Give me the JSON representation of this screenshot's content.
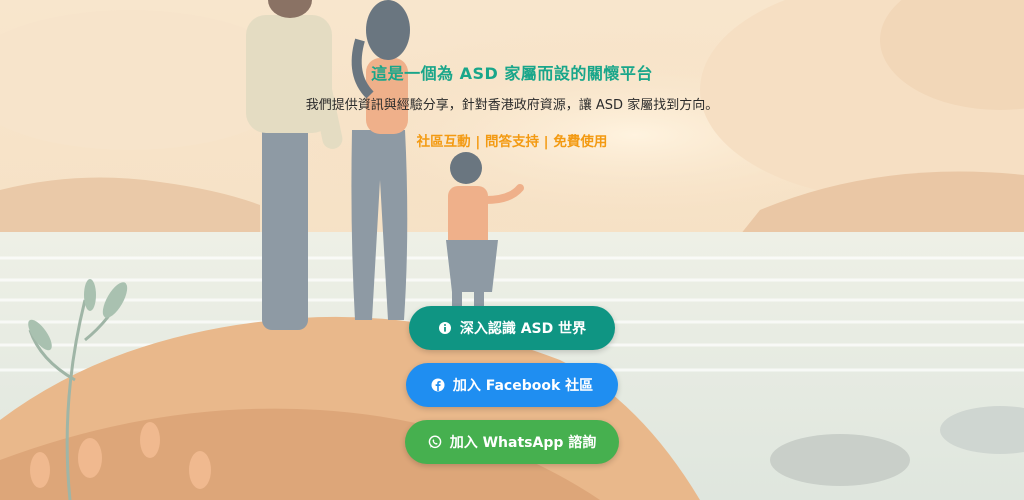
{
  "hero": {
    "headline": "這是一個為 ASD 家屬而設的關懷平台",
    "subline": "我們提供資訊與經驗分享，針對香港政府資源，讓 ASD 家屬找到方向。",
    "features": "社區互動 | 問答支持 | 免費使用"
  },
  "buttons": {
    "learn": {
      "label": "深入認識 ASD 世界",
      "icon": "info-icon",
      "color": "#0f9583"
    },
    "facebook": {
      "label": "加入 Facebook 社區",
      "icon": "facebook-icon",
      "color": "#1f8ef1"
    },
    "whatsapp": {
      "label": "加入 WhatsApp 諮詢",
      "icon": "whatsapp-icon",
      "color": "#46b04f"
    }
  },
  "colors": {
    "headline": "#19a68a",
    "features": "#f39a12",
    "background": "#f6e3c8"
  }
}
